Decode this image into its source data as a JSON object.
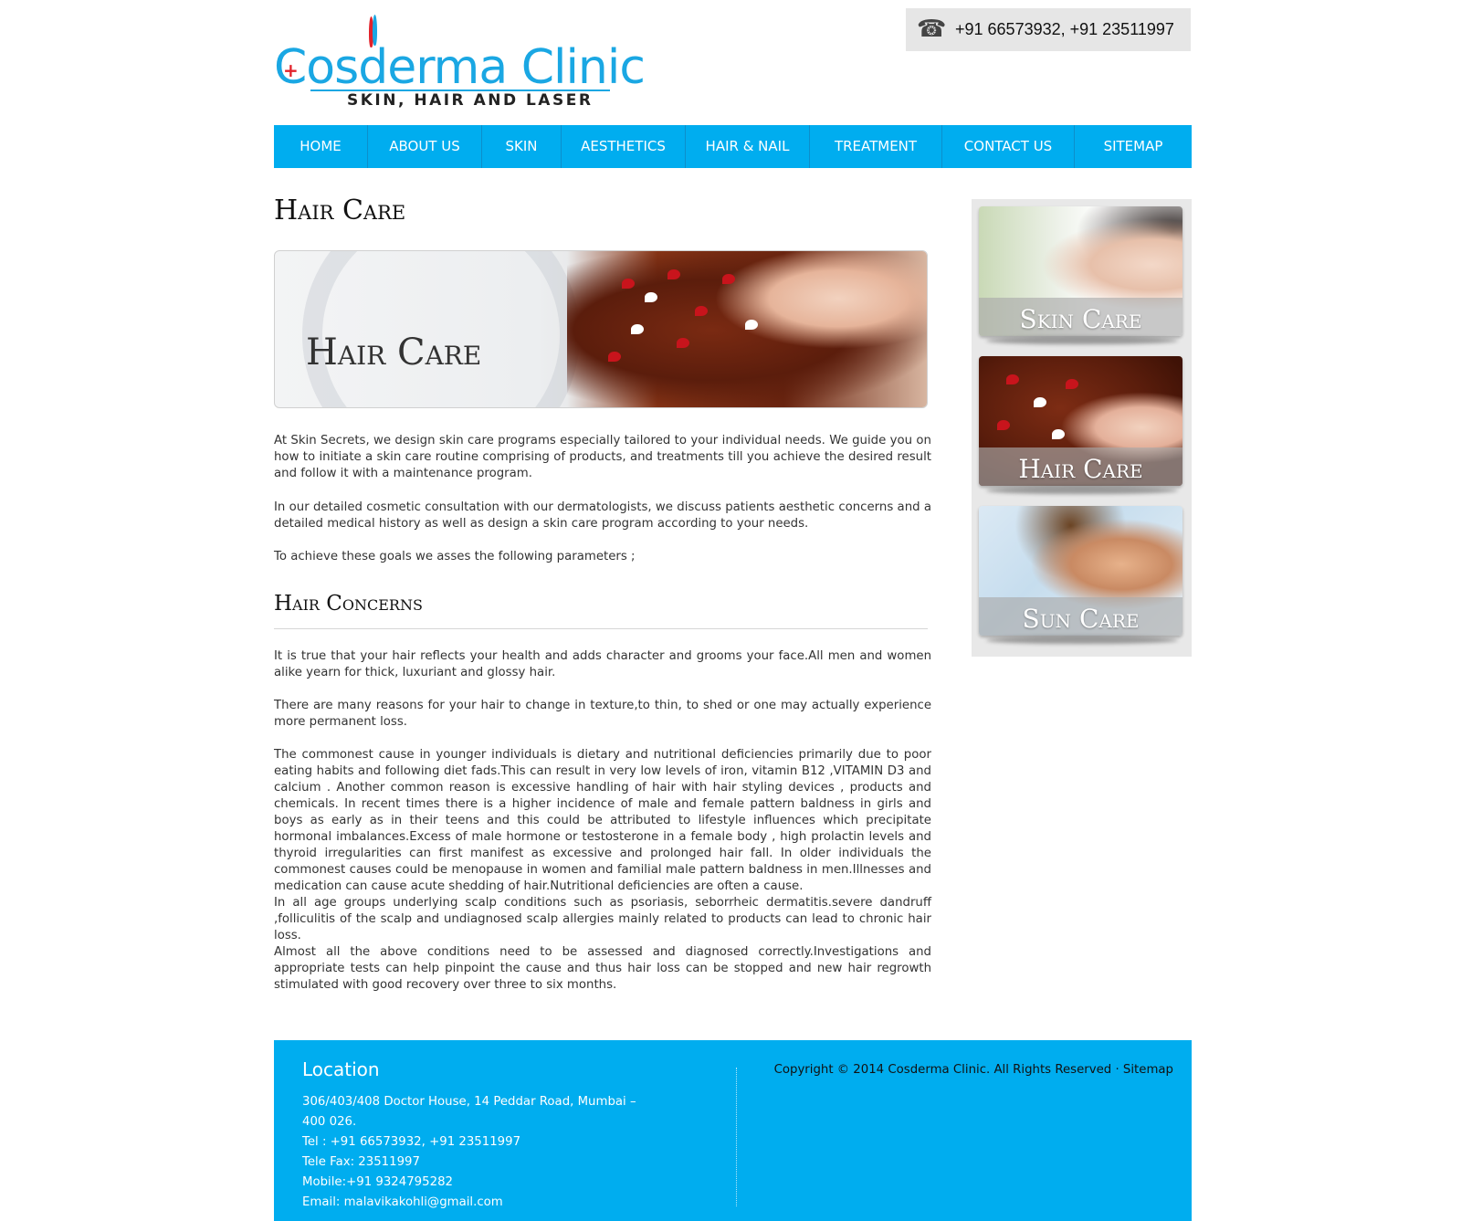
{
  "header": {
    "logo_title": "Cosderma Clinic",
    "logo_subtitle": "SKIN, HAIR AND LASER",
    "phone_icon": "telephone-icon",
    "phone": "+91 66573932, +91 23511997"
  },
  "nav": {
    "items": [
      "HOME",
      "ABOUT US",
      "SKIN",
      "AESTHETICS",
      "HAIR & NAIL",
      "TREATMENT",
      "CONTACT US",
      "SITEMAP"
    ]
  },
  "main": {
    "title": "Hair Care",
    "banner_title": "Hair Care",
    "intro": [
      "At Skin Secrets, we design skin care programs especially tailored to your individual needs. We guide you on how to initiate a skin care routine comprising of products, and treatments till you achieve the desired result and follow it with a maintenance program.",
      "In our detailed cosmetic consultation with our dermatologists, we discuss patients aesthetic concerns and a detailed medical history as well as design a skin care program according to your needs.",
      "To achieve these goals we asses the following parameters ;"
    ],
    "subtitle": "Hair Concerns",
    "concerns": [
      "It is true that your hair reflects your health and adds character and grooms your face.All men and women alike yearn for thick, luxuriant and glossy hair.",
      "There are many reasons for your hair to change in texture,to thin, to shed or one may actually experience more permanent loss.",
      "The commonest cause in younger individuals is dietary and nutritional deficiencies primarily due to poor eating habits and following diet fads.This can result in very low levels of iron, vitamin B12 ,VITAMIN D3 and calcium . Another common reason is excessive handling of hair with hair styling devices , products and chemicals. In recent times there is a higher incidence of male and female pattern baldness in girls and boys as early as in their teens and this could be attributed to lifestyle influences which precipitate hormonal imbalances.Excess of male hormone or testosterone in a female body , high prolactin levels and thyroid irregularities can first manifest as excessive and prolonged hair fall. In older individuals the commonest causes could be menopause in women and familial male pattern baldness in men.Illnesses and medication can cause acute shedding of hair.Nutritional deficiencies are often a cause.",
      "In all age groups underlying scalp conditions such as psoriasis, seborrheic dermatitis.severe dandruff ,folliculitis of the scalp and undiagnosed scalp allergies mainly related to products can lead to chronic hair loss.",
      "Almost all the above conditions need to be assessed and diagnosed correctly.Investigations and appropriate tests can help pinpoint the cause and thus hair loss can be stopped and new hair regrowth stimulated with good recovery over three to six months."
    ]
  },
  "sidebar": {
    "cards": [
      "Skin Care",
      "Hair Care",
      "Sun Care"
    ]
  },
  "footer": {
    "title": "Location",
    "address": "306/403/408 Doctor House, 14 Peddar Road, Mumbai – 400 026.",
    "tel": "Tel : +91 66573932, +91 23511997",
    "fax": "Tele Fax: 23511997",
    "mobile": "Mobile:+91 9324795282",
    "email": "Email: malavikakohli@gmail.com",
    "copyright": "Copyright © 2014 Cosderma Clinic. All Rights Reserved ·",
    "sitemap": "Sitemap"
  },
  "colors": {
    "brand_blue": "#00adef",
    "logo_red": "#e2232b"
  }
}
